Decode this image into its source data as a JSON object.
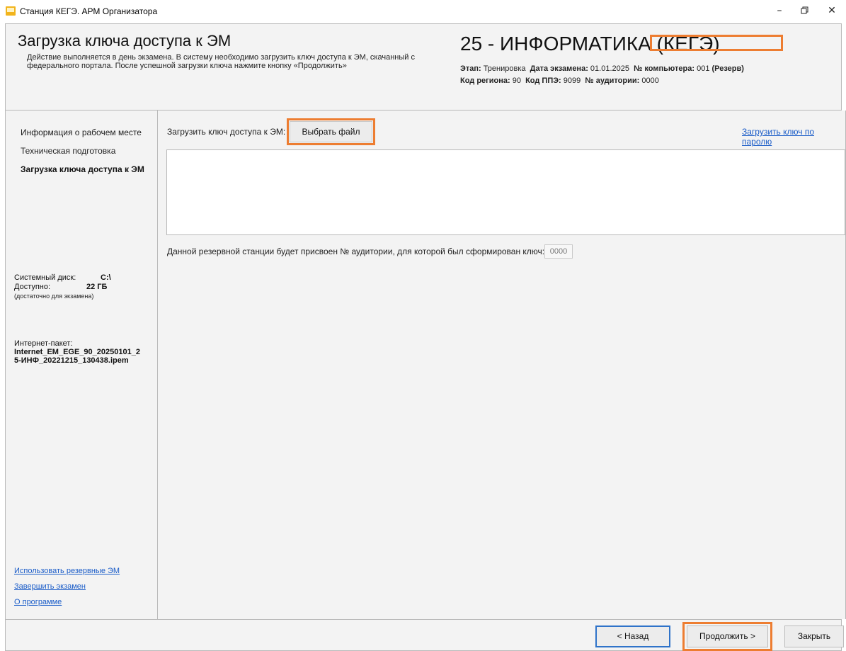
{
  "window": {
    "title": "Станция КЕГЭ. АРМ Организатора",
    "minimize_icon": "minimize-icon",
    "restore_icon": "restore-icon",
    "close_icon": "close-icon"
  },
  "header": {
    "title": "Загрузка ключа доступа к ЭМ",
    "description": "Действие выполняется в день экзамена. В систему необходимо загрузить ключ доступа к ЭМ, скачанный с федерального портала. После успешной загрузки ключа нажмите кнопку «Продолжить»",
    "subject": "25 - ИНФОРМАТИКА (КЕГЭ)",
    "stage_label": "Этап:",
    "stage_value": "Тренировка",
    "exam_date_label": "Дата экзамена:",
    "exam_date_value": "01.01.2025",
    "computer_label": "№ компьютера:",
    "computer_value": "001",
    "computer_note": "(Резерв)",
    "region_label": "Код региона:",
    "region_value": "90",
    "ppe_label": "Код ППЭ:",
    "ppe_value": "9099",
    "room_label": "№ аудитории:",
    "room_value": "0000"
  },
  "sidebar": {
    "items": [
      {
        "label": "Информация о рабочем месте"
      },
      {
        "label": "Техническая подготовка"
      },
      {
        "label": "Загрузка ключа доступа к ЭМ"
      }
    ],
    "disk_label": "Системный диск:",
    "disk_value": "C:\\",
    "available_label": "Доступно:",
    "available_value": "22 ГБ",
    "available_note": "(достаточно для экзамена)",
    "package_label": "Интернет-пакет:",
    "package_line1": "Internet_EM_EGE_90_20250101_2",
    "package_line2": "5-ИНФ_20221215_130438.ipem",
    "links": [
      {
        "label": "Использовать резервные ЭМ"
      },
      {
        "label": "Завершить экзамен"
      },
      {
        "label": "О программе"
      }
    ]
  },
  "main": {
    "upload_label": "Загрузить ключ доступа к ЭМ:",
    "choose_file": "Выбрать файл",
    "password_link": "Загрузить ключ по паролю",
    "key_content": "",
    "room_note": "Данной резервной станции будет присвоен № аудитории, для которой был сформирован ключ:",
    "room_field_value": "0000"
  },
  "footer": {
    "back": "< Назад",
    "next": "Продолжить >",
    "close": "Закрыть"
  },
  "colors": {
    "highlight": "#ed7d31",
    "link": "#1a5cc8",
    "panel": "#f3f3f3",
    "focus": "#2f73c9"
  }
}
